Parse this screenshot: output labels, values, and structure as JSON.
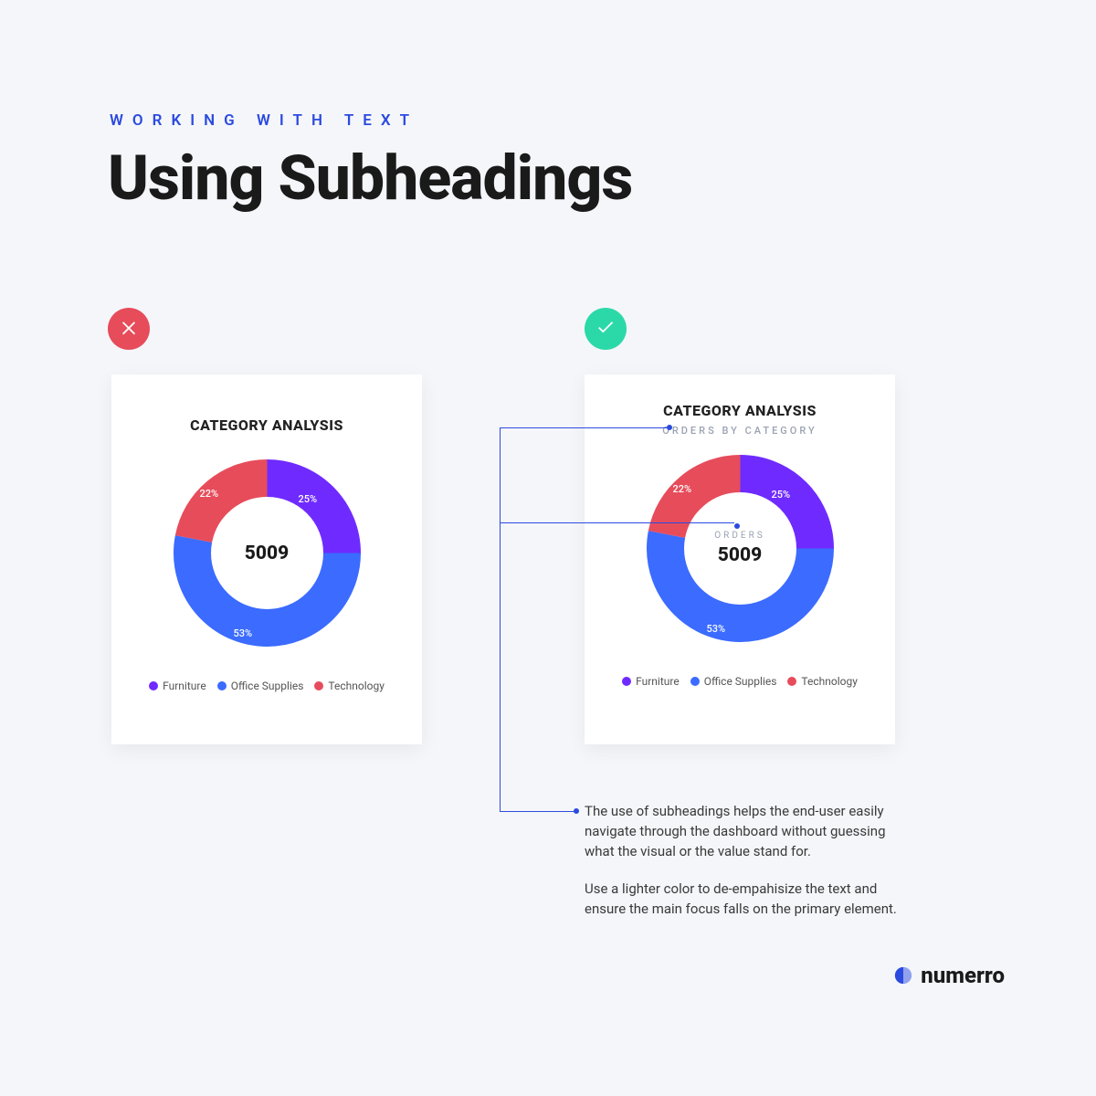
{
  "header": {
    "overline": "WORKING WITH TEXT",
    "title": "Using Subheadings"
  },
  "chart_data": [
    {
      "type": "pie",
      "variant": "donut",
      "title": "CATEGORY ANALYSIS",
      "subtitle": null,
      "center_value": "5009",
      "center_label": null,
      "series": [
        {
          "name": "Furniture",
          "value": 25,
          "label": "25%",
          "color": "#6f2bff"
        },
        {
          "name": "Office Supplies",
          "value": 53,
          "label": "53%",
          "color": "#3b6bff"
        },
        {
          "name": "Technology",
          "value": 22,
          "label": "22%",
          "color": "#e74c5b"
        }
      ]
    },
    {
      "type": "pie",
      "variant": "donut",
      "title": "CATEGORY ANALYSIS",
      "subtitle": "ORDERS BY CATEGORY",
      "center_value": "5009",
      "center_label": "ORDERS",
      "series": [
        {
          "name": "Furniture",
          "value": 25,
          "label": "25%",
          "color": "#6f2bff"
        },
        {
          "name": "Office Supplies",
          "value": 53,
          "label": "53%",
          "color": "#3b6bff"
        },
        {
          "name": "Technology",
          "value": 22,
          "label": "22%",
          "color": "#e74c5b"
        }
      ]
    }
  ],
  "annotation": {
    "p1": "The use of subheadings helps the end-user easily navigate through the dashboard without guessing what the visual or the value stand for.",
    "p2": "Use a lighter color to de-empahisize the text and ensure the main focus falls on the primary element."
  },
  "brand": {
    "name": "numerro"
  }
}
